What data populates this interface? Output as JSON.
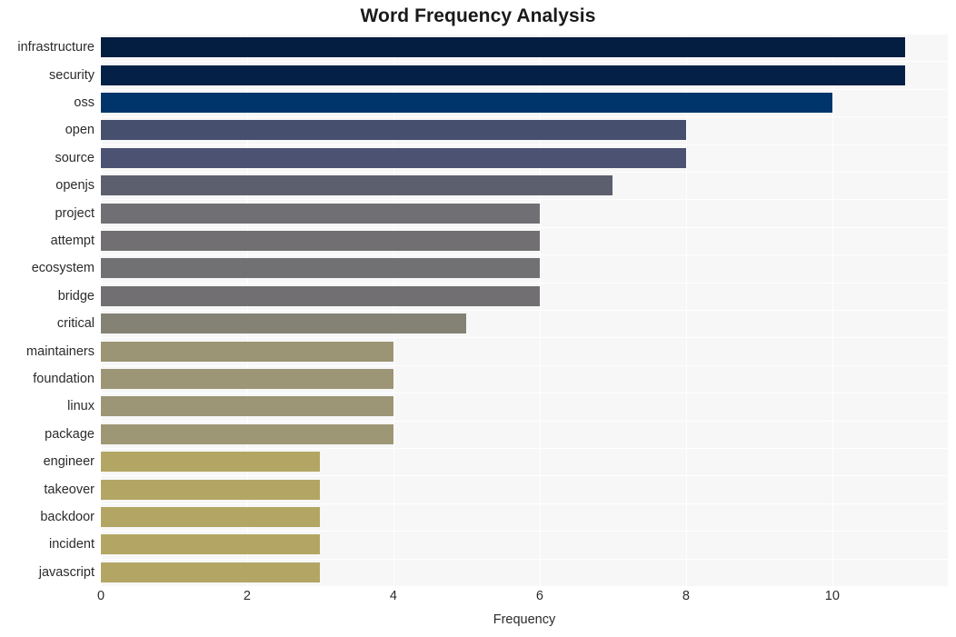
{
  "chart_data": {
    "type": "bar",
    "orientation": "horizontal",
    "title": "Word Frequency Analysis",
    "xlabel": "Frequency",
    "ylabel": "",
    "xlim": [
      0,
      11.58
    ],
    "xticks": [
      0,
      2,
      4,
      6,
      8,
      10
    ],
    "grid": true,
    "legend": "none",
    "categories": [
      "infrastructure",
      "security",
      "oss",
      "open",
      "source",
      "openjs",
      "project",
      "attempt",
      "ecosystem",
      "bridge",
      "critical",
      "maintainers",
      "foundation",
      "linux",
      "package",
      "engineer",
      "takeover",
      "backdoor",
      "incident",
      "javascript"
    ],
    "values": [
      11,
      11,
      10,
      8,
      8,
      7,
      6,
      6,
      6,
      6,
      5,
      4,
      4,
      4,
      4,
      3,
      3,
      3,
      3,
      3
    ],
    "bar_colors": [
      "#041E42",
      "#042046",
      "#00356B",
      "#474F6E",
      "#4B5272",
      "#5C5F6D",
      "#706F73",
      "#716F72",
      "#717073",
      "#716F71",
      "#838274",
      "#9B9475",
      "#9C9576",
      "#9C9576",
      "#9E9776",
      "#B3A664",
      "#B3A664",
      "#B3A664",
      "#B3A664",
      "#B3A664"
    ],
    "plot_background": "#f7f7f7",
    "gridline_color": "#ffffff",
    "page_background": "#ffffff",
    "title_color": "#1a1a1a",
    "tick_color": "#2b2b2b"
  }
}
